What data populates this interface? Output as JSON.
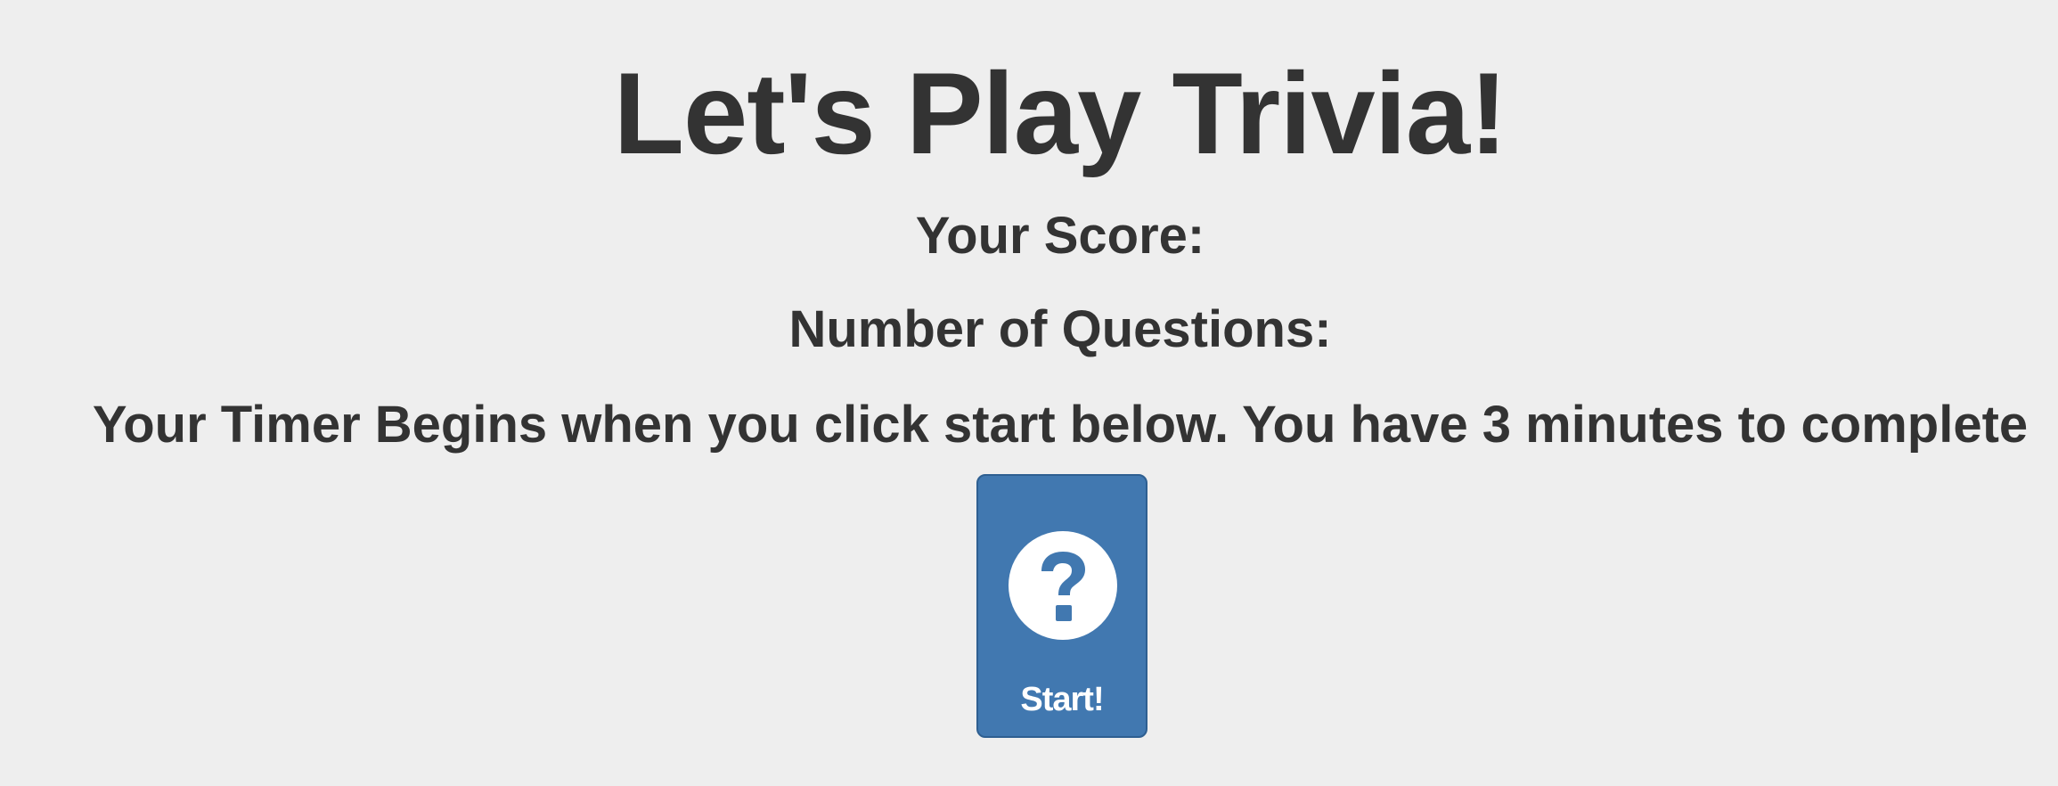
{
  "header": {
    "title": "Let's Play Trivia!"
  },
  "stats": {
    "score_label": "Your Score:",
    "questions_label": "Number of Questions:"
  },
  "instructions": {
    "text": "Your Timer Begins when you click start below. You have 3 minutes to complete"
  },
  "start_button": {
    "label": "Start!",
    "icon": "question-circle-icon"
  },
  "colors": {
    "background": "#eeeeee",
    "text": "#333333",
    "button": "#4178b0",
    "button_text": "#ffffff"
  }
}
